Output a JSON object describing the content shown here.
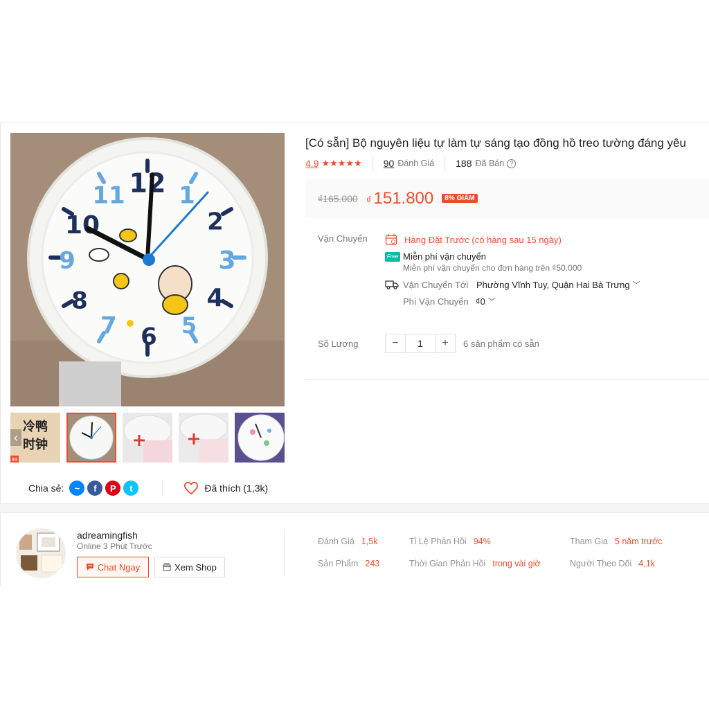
{
  "product": {
    "title": "[Có sẵn] Bộ nguyên liệu tự làm tự sáng tạo đồng hồ treo tường đáng yêu",
    "rating": "4.9",
    "stars": "★★★★★",
    "review_count": "90",
    "review_label": "Đánh Giá",
    "sold_count": "188",
    "sold_label": "Đã Bán",
    "help_glyph": "?",
    "old_price": "₫165.000",
    "currency": "₫",
    "price": "151.800",
    "discount": "8% GIẢM"
  },
  "gallery": {
    "clock_numbers": [
      "12",
      "1",
      "2",
      "3",
      "4",
      "5",
      "6",
      "7",
      "8",
      "9",
      "10",
      "11"
    ],
    "thumb1_text": [
      "冷鸭",
      "时钟"
    ],
    "thumb1_badge": "99",
    "arrow_glyph": "‹"
  },
  "shipping": {
    "label": "Vận Chuyển",
    "preorder": "Hàng Đặt Trước (có hàng sau 15 ngày)",
    "free_badge": "Free",
    "free_title": "Miễn phí vận chuyển",
    "free_desc": "Miễn phí vận chuyển cho đơn hàng trên ₫50.000",
    "to_label": "Vận Chuyển Tới",
    "to_value": "Phường Vĩnh Tuy, Quận Hai Bà Trưng",
    "fee_label": "Phí Vận Chuyển",
    "fee_value": "₫0",
    "chevron": "﹀"
  },
  "quantity": {
    "label": "Số Lượng",
    "minus": "−",
    "value": "1",
    "plus": "+",
    "stock": "6 sản phẩm có sẵn"
  },
  "share": {
    "label": "Chia sẻ:",
    "liked": "Đã thích (1,3k)",
    "messenger_glyph": "~",
    "facebook_glyph": "f",
    "pinterest_glyph": "P",
    "twitter_glyph": "t"
  },
  "shop": {
    "name": "adreamingfish",
    "online": "Online 3 Phút Trước",
    "chat_label": "Chat Ngay",
    "view_label": "Xem Shop",
    "stats": [
      {
        "k": "Đánh Giá",
        "v": "1,5k"
      },
      {
        "k": "Tỉ Lệ Phản Hồi",
        "v": "94%"
      },
      {
        "k": "Tham Gia",
        "v": "5 năm trước"
      },
      {
        "k": "Sản Phẩm",
        "v": "243"
      },
      {
        "k": "Thời Gian Phản Hồi",
        "v": "trong vài giờ"
      },
      {
        "k": "Người Theo Dõi",
        "v": "4,1k"
      }
    ]
  },
  "colors": {
    "accent": "#ee4d2d",
    "clock_navy": "#1e2f5c",
    "clock_blue": "#64a8e0",
    "free_teal": "#00bfa5"
  }
}
